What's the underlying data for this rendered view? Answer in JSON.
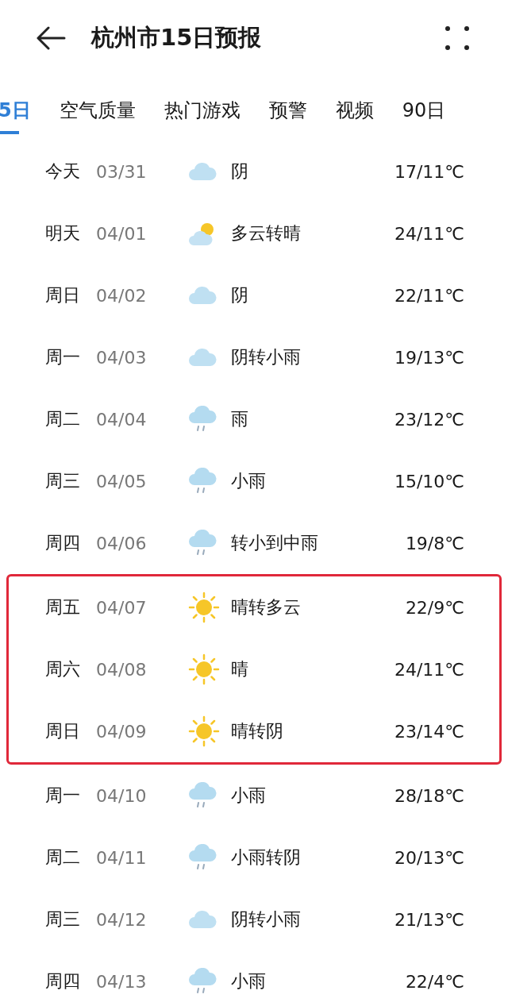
{
  "header": {
    "title": "杭州市15日预报"
  },
  "tabs": [
    {
      "label": "5日",
      "selected": true
    },
    {
      "label": "空气质量",
      "selected": false
    },
    {
      "label": "热门游戏",
      "selected": false
    },
    {
      "label": "预警",
      "selected": false
    },
    {
      "label": "视频",
      "selected": false
    },
    {
      "label": "90日",
      "selected": false
    }
  ],
  "days": [
    {
      "day": "今天",
      "date": "03/31",
      "kind": "cloud",
      "condition": "阴",
      "temp": "17/11℃",
      "highlighted": false
    },
    {
      "day": "明天",
      "date": "04/01",
      "kind": "sun-cloud",
      "condition": "多云转晴",
      "temp": "24/11℃",
      "highlighted": false
    },
    {
      "day": "周日",
      "date": "04/02",
      "kind": "cloud",
      "condition": "阴",
      "temp": "22/11℃",
      "highlighted": false
    },
    {
      "day": "周一",
      "date": "04/03",
      "kind": "cloud",
      "condition": "阴转小雨",
      "temp": "19/13℃",
      "highlighted": false
    },
    {
      "day": "周二",
      "date": "04/04",
      "kind": "rain",
      "condition": "雨",
      "temp": "23/12℃",
      "highlighted": false
    },
    {
      "day": "周三",
      "date": "04/05",
      "kind": "rain",
      "condition": "小雨",
      "temp": "15/10℃",
      "highlighted": false
    },
    {
      "day": "周四",
      "date": "04/06",
      "kind": "rain",
      "condition": "转小到中雨",
      "temp": "19/8℃",
      "highlighted": false
    },
    {
      "day": "周五",
      "date": "04/07",
      "kind": "sun",
      "condition": "晴转多云",
      "temp": "22/9℃",
      "highlighted": true
    },
    {
      "day": "周六",
      "date": "04/08",
      "kind": "sun",
      "condition": "晴",
      "temp": "24/11℃",
      "highlighted": true
    },
    {
      "day": "周日",
      "date": "04/09",
      "kind": "sun",
      "condition": "晴转阴",
      "temp": "23/14℃",
      "highlighted": true
    },
    {
      "day": "周一",
      "date": "04/10",
      "kind": "rain",
      "condition": "小雨",
      "temp": "28/18℃",
      "highlighted": false
    },
    {
      "day": "周二",
      "date": "04/11",
      "kind": "rain",
      "condition": "小雨转阴",
      "temp": "20/13℃",
      "highlighted": false
    },
    {
      "day": "周三",
      "date": "04/12",
      "kind": "cloud",
      "condition": "阴转小雨",
      "temp": "21/13℃",
      "highlighted": false
    },
    {
      "day": "周四",
      "date": "04/13",
      "kind": "rain",
      "condition": "小雨",
      "temp": "22/4℃",
      "highlighted": false
    }
  ]
}
